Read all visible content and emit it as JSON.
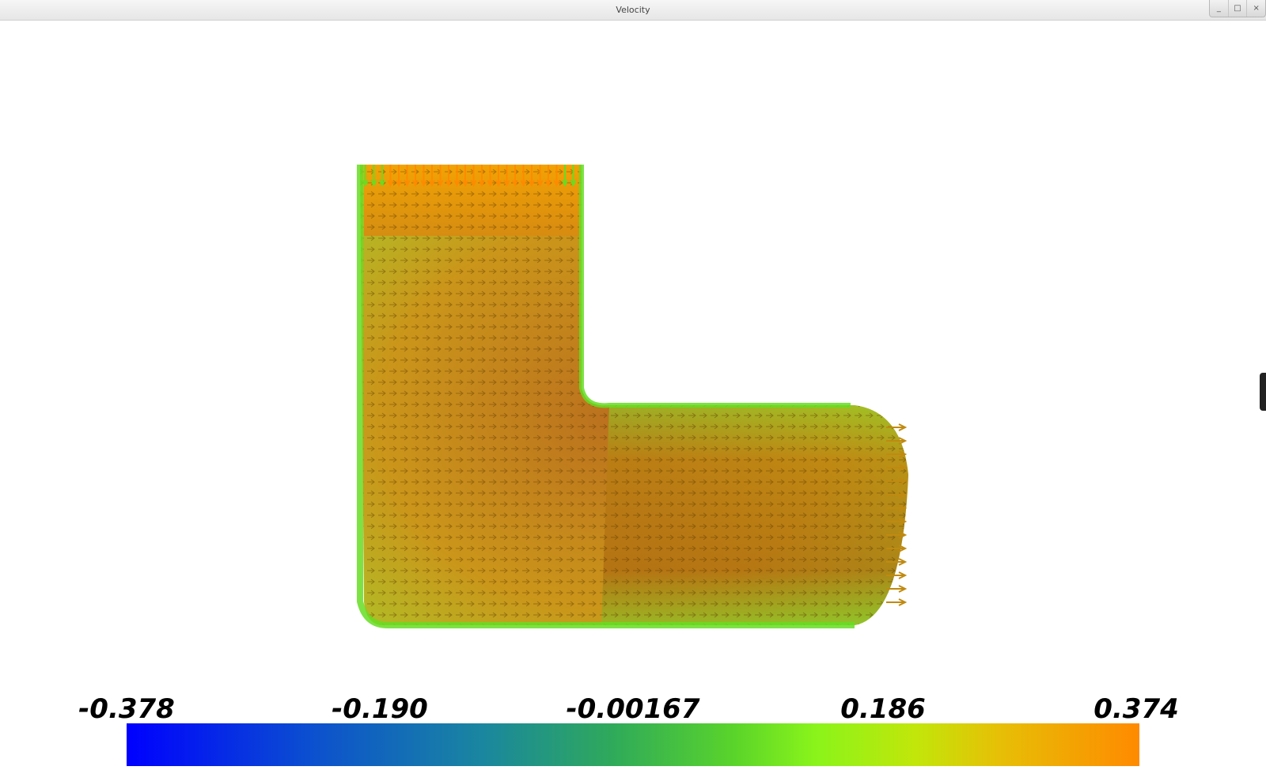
{
  "window": {
    "title": "Velocity",
    "controls": {
      "minimize": "_",
      "maximize": "□",
      "close": "×"
    }
  },
  "colorbar": {
    "labels": [
      "-0.378",
      "-0.190",
      "-0.00167",
      "0.186",
      "0.374"
    ],
    "colors": [
      "#0000ff",
      "#1a86a0",
      "#5ad42a",
      "#c2e60a",
      "#ff8a00"
    ]
  },
  "visualization": {
    "type": "vector-field",
    "glyph": "arrow-icon",
    "domain_shape": "L-shaped pipe elbow",
    "colors": {
      "low": "#66dd22",
      "mid": "#c08a10",
      "high": "#ff8a00",
      "outline": "#3a8a00"
    }
  }
}
